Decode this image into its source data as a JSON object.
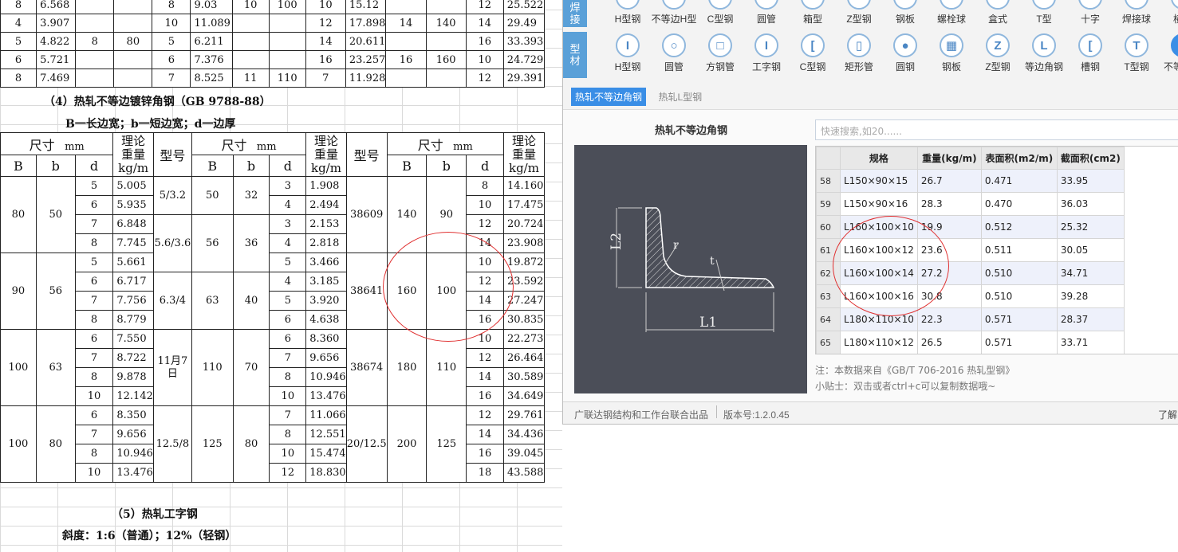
{
  "sheet": {
    "top_table": [
      [
        "8",
        "6.568",
        "",
        "",
        "8",
        "9.03",
        "10",
        "100",
        "10",
        "15.12",
        "",
        "",
        "12",
        "25.522"
      ],
      [
        "4",
        "3.907",
        "",
        "",
        "10",
        "11.089",
        "",
        "",
        "12",
        "17.898",
        "14",
        "140",
        "14",
        "29.49"
      ],
      [
        "5",
        "4.822",
        "8",
        "80",
        "5",
        "6.211",
        "",
        "",
        "14",
        "20.611",
        "",
        "",
        "16",
        "33.393"
      ],
      [
        "6",
        "5.721",
        "",
        "",
        "6",
        "7.376",
        "",
        "",
        "16",
        "23.257",
        "16",
        "160",
        "10",
        "24.729"
      ],
      [
        "8",
        "7.469",
        "",
        "",
        "7",
        "8.525",
        "11",
        "110",
        "7",
        "11.928",
        "",
        "",
        "12",
        "29.391"
      ]
    ],
    "heading4": "（4）热轧不等边镀锌角钢（GB 9788-88）",
    "subheading4": "B一长边宽；b一短边宽；d一边厚",
    "hdr": {
      "size": "尺寸",
      "unit": "mm",
      "weight": "理论\n重量\nkg/m",
      "model": "型号",
      "B": "B",
      "b": "b",
      "d": "d"
    },
    "groups": [
      {
        "B": "80",
        "b": "50",
        "rows": [
          [
            "5",
            "5.005"
          ],
          [
            "6",
            "5.935"
          ],
          [
            "7",
            "6.848"
          ],
          [
            "8",
            "7.745"
          ]
        ]
      },
      {
        "B": "90",
        "b": "56",
        "rows": [
          [
            "5",
            "5.661"
          ],
          [
            "6",
            "6.717"
          ],
          [
            "7",
            "7.756"
          ],
          [
            "8",
            "8.779"
          ]
        ]
      },
      {
        "B": "100",
        "b": "63",
        "rows": [
          [
            "6",
            "7.550"
          ],
          [
            "7",
            "8.722"
          ],
          [
            "8",
            "9.878"
          ],
          [
            "10",
            "12.142"
          ]
        ]
      },
      {
        "B": "100",
        "b": "80",
        "rows": [
          [
            "6",
            "8.350"
          ],
          [
            "7",
            "9.656"
          ],
          [
            "8",
            "10.946"
          ],
          [
            "10",
            "13.476"
          ]
        ]
      }
    ],
    "mid_groups": [
      {
        "model": "5/3.2",
        "B": "50",
        "b": "32",
        "rows": [
          [
            "3",
            "1.908"
          ],
          [
            "4",
            "2.494"
          ]
        ]
      },
      {
        "model": "5.6/3.6",
        "B": "56",
        "b": "36",
        "rows": [
          [
            "3",
            "2.153"
          ],
          [
            "4",
            "2.818"
          ],
          [
            "5",
            "3.466"
          ]
        ]
      },
      {
        "model": "6.3/4",
        "B": "63",
        "b": "40",
        "rows": [
          [
            "4",
            "3.185"
          ],
          [
            "5",
            "3.920"
          ],
          [
            "6",
            "4.638"
          ]
        ]
      },
      {
        "model": "11月7日",
        "B": "110",
        "b": "70",
        "rows": [
          [
            "6",
            "8.360"
          ],
          [
            "7",
            "9.656"
          ],
          [
            "8",
            "10.946"
          ],
          [
            "10",
            "13.476"
          ]
        ]
      },
      {
        "model": "12.5/8",
        "B": "125",
        "b": "80",
        "rows": [
          [
            "7",
            "11.066"
          ],
          [
            "8",
            "12.551"
          ],
          [
            "10",
            "15.474"
          ],
          [
            "12",
            "18.830"
          ]
        ]
      }
    ],
    "right_groups": [
      {
        "model": "38609",
        "B": "140",
        "b": "90",
        "rows": [
          [
            "8",
            "14.160"
          ],
          [
            "10",
            "17.475"
          ],
          [
            "12",
            "20.724"
          ],
          [
            "14",
            "23.908"
          ]
        ]
      },
      {
        "model": "38641",
        "B": "160",
        "b": "100",
        "rows": [
          [
            "10",
            "19.872"
          ],
          [
            "12",
            "23.592"
          ],
          [
            "14",
            "27.247"
          ],
          [
            "16",
            "30.835"
          ]
        ]
      },
      {
        "model": "38674",
        "B": "180",
        "b": "110",
        "rows": [
          [
            "10",
            "22.273"
          ],
          [
            "12",
            "26.464"
          ],
          [
            "14",
            "30.589"
          ],
          [
            "16",
            "34.649"
          ]
        ]
      },
      {
        "model": "20/12.5",
        "B": "200",
        "b": "125",
        "rows": [
          [
            "12",
            "29.761"
          ],
          [
            "14",
            "34.436"
          ],
          [
            "16",
            "39.045"
          ],
          [
            "18",
            "43.588"
          ]
        ]
      }
    ],
    "heading5": "（5）热轧工字钢",
    "subheading5": "斜度：1:6（普通）；12%（轻钢）"
  },
  "app": {
    "cat_weld": "焊\n接",
    "cat_profile": "型\n材",
    "weld_items": [
      "H型钢",
      "不等边H型",
      "C型钢",
      "圆管",
      "箱型",
      "Z型钢",
      "钢板",
      "螺栓球",
      "盒式",
      "T型",
      "十字",
      "焊接球",
      "横托"
    ],
    "profile_items": [
      {
        "label": "H型钢",
        "icon": "I"
      },
      {
        "label": "圆管",
        "icon": "○"
      },
      {
        "label": "方钢管",
        "icon": "□"
      },
      {
        "label": "工字钢",
        "icon": "I"
      },
      {
        "label": "C型钢",
        "icon": "["
      },
      {
        "label": "矩形管",
        "icon": "▯"
      },
      {
        "label": "圆钢",
        "icon": "●"
      },
      {
        "label": "钢板",
        "icon": "▦"
      },
      {
        "label": "Z型钢",
        "icon": "Z"
      },
      {
        "label": "等边角钢",
        "icon": "L"
      },
      {
        "label": "槽钢",
        "icon": "["
      },
      {
        "label": "T型钢",
        "icon": "T"
      },
      {
        "label": "不等边角",
        "icon": "L"
      }
    ],
    "tabs": [
      "热轧不等边角钢",
      "热轧L型钢"
    ],
    "diagram_title": "热轧不等边角钢",
    "search_placeholder": "快速搜索,如20......",
    "grid_headers": [
      "规格",
      "重量(kg/m)",
      "表面积(m2/m)",
      "截面积(cm2)"
    ],
    "grid_rows": [
      [
        "58",
        "L150×90×15",
        "26.7",
        "0.471",
        "33.95"
      ],
      [
        "59",
        "L150×90×16",
        "28.3",
        "0.470",
        "36.03"
      ],
      [
        "60",
        "L160×100×10",
        "19.9",
        "0.512",
        "25.32"
      ],
      [
        "61",
        "L160×100×12",
        "23.6",
        "0.511",
        "30.05"
      ],
      [
        "62",
        "L160×100×14",
        "27.2",
        "0.510",
        "34.71"
      ],
      [
        "63",
        "L160×100×16",
        "30.8",
        "0.510",
        "39.28"
      ],
      [
        "64",
        "L180×110×10",
        "22.3",
        "0.571",
        "28.37"
      ],
      [
        "65",
        "L180×110×12",
        "26.5",
        "0.571",
        "33.71"
      ]
    ],
    "diagram_labels": {
      "l2": "L2",
      "l1": "L1",
      "r": "r",
      "t": "t"
    },
    "note1": "注：本数据来自《GB/T 706-2016 热轧型钢》",
    "note2": "小贴士：双击或者ctrl+c可以复制数据哦~",
    "footer_left": "广联达钢结构和工作台联合出品",
    "footer_version": "版本号:1.2.0.45",
    "footer_right": "了解"
  }
}
